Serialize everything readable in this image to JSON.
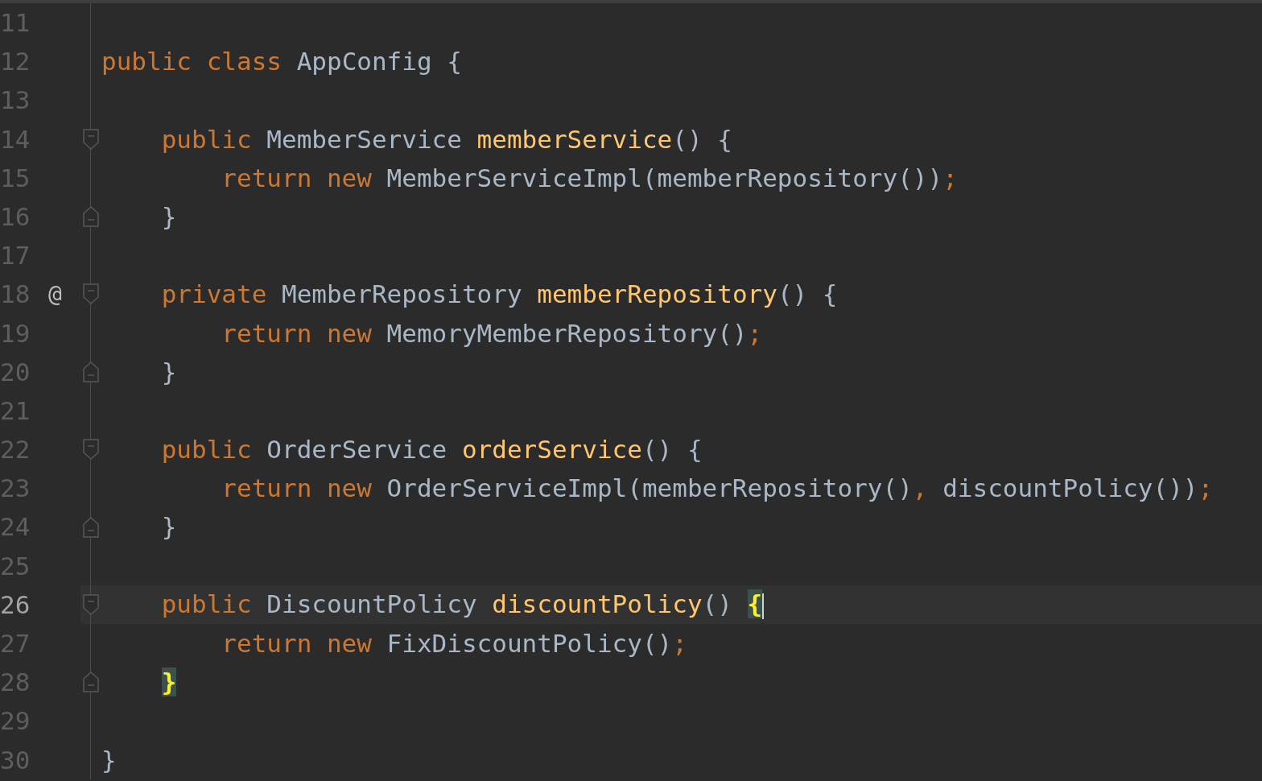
{
  "lines": [
    {
      "number": "11",
      "current": false,
      "caret": false,
      "fold_start": false,
      "fold_end": false
    },
    {
      "number": "12",
      "current": false,
      "caret": false,
      "fold_start": false,
      "fold_end": false,
      "tokens": [
        {
          "kind": "keyword",
          "text": "public class "
        },
        {
          "kind": "plain",
          "text": "AppConfig {"
        }
      ]
    },
    {
      "number": "13",
      "current": false,
      "caret": false,
      "fold_start": false,
      "fold_end": false
    },
    {
      "number": "14",
      "current": false,
      "caret": false,
      "fold_start": true,
      "fold_end": false,
      "tokens": [
        {
          "kind": "keyword",
          "text": "    public "
        },
        {
          "kind": "plain",
          "text": "MemberService "
        },
        {
          "kind": "method",
          "text": "memberService"
        },
        {
          "kind": "plain",
          "text": "() {"
        }
      ]
    },
    {
      "number": "15",
      "current": false,
      "caret": false,
      "fold_start": false,
      "fold_end": false,
      "tokens": [
        {
          "kind": "keyword",
          "text": "        return new "
        },
        {
          "kind": "plain",
          "text": "MemberServiceImpl(memberRepository())"
        },
        {
          "kind": "keyword",
          "text": ";"
        }
      ]
    },
    {
      "number": "16",
      "current": false,
      "caret": false,
      "fold_start": false,
      "fold_end": true,
      "tokens": [
        {
          "kind": "plain",
          "text": "    }"
        }
      ]
    },
    {
      "number": "17",
      "current": false,
      "caret": false,
      "fold_start": false,
      "fold_end": false
    },
    {
      "number": "18",
      "current": false,
      "caret": false,
      "fold_start": true,
      "fold_end": false,
      "gutter_mark": "@",
      "tokens": [
        {
          "kind": "keyword",
          "text": "    private "
        },
        {
          "kind": "plain",
          "text": "MemberRepository "
        },
        {
          "kind": "method",
          "text": "memberRepository"
        },
        {
          "kind": "plain",
          "text": "() {"
        }
      ]
    },
    {
      "number": "19",
      "current": false,
      "caret": false,
      "fold_start": false,
      "fold_end": false,
      "tokens": [
        {
          "kind": "keyword",
          "text": "        return new "
        },
        {
          "kind": "plain",
          "text": "MemoryMemberRepository()"
        },
        {
          "kind": "keyword",
          "text": ";"
        }
      ]
    },
    {
      "number": "20",
      "current": false,
      "caret": false,
      "fold_start": false,
      "fold_end": true,
      "tokens": [
        {
          "kind": "plain",
          "text": "    }"
        }
      ]
    },
    {
      "number": "21",
      "current": false,
      "caret": false,
      "fold_start": false,
      "fold_end": false
    },
    {
      "number": "22",
      "current": false,
      "caret": false,
      "fold_start": true,
      "fold_end": false,
      "tokens": [
        {
          "kind": "keyword",
          "text": "    public "
        },
        {
          "kind": "plain",
          "text": "OrderService "
        },
        {
          "kind": "method",
          "text": "orderService"
        },
        {
          "kind": "plain",
          "text": "() {"
        }
      ]
    },
    {
      "number": "23",
      "current": false,
      "caret": false,
      "fold_start": false,
      "fold_end": false,
      "tokens": [
        {
          "kind": "keyword",
          "text": "        return new "
        },
        {
          "kind": "plain",
          "text": "OrderServiceImpl(memberRepository()"
        },
        {
          "kind": "keyword",
          "text": ", "
        },
        {
          "kind": "plain",
          "text": "discountPolicy())"
        },
        {
          "kind": "keyword",
          "text": ";"
        }
      ]
    },
    {
      "number": "24",
      "current": false,
      "caret": false,
      "fold_start": false,
      "fold_end": true,
      "tokens": [
        {
          "kind": "plain",
          "text": "    }"
        }
      ]
    },
    {
      "number": "25",
      "current": false,
      "caret": false,
      "fold_start": false,
      "fold_end": false
    },
    {
      "number": "26",
      "current": true,
      "caret": true,
      "fold_start": true,
      "fold_end": false,
      "tokens": [
        {
          "kind": "keyword",
          "text": "    public "
        },
        {
          "kind": "plain",
          "text": "DiscountPolicy "
        },
        {
          "kind": "method",
          "text": "discountPolicy"
        },
        {
          "kind": "plain",
          "text": "() "
        },
        {
          "kind": "brace-match",
          "text": "{"
        }
      ]
    },
    {
      "number": "27",
      "current": false,
      "caret": false,
      "fold_start": false,
      "fold_end": false,
      "tokens": [
        {
          "kind": "keyword",
          "text": "        return new "
        },
        {
          "kind": "plain",
          "text": "FixDiscountPolicy()"
        },
        {
          "kind": "keyword",
          "text": ";"
        }
      ]
    },
    {
      "number": "28",
      "current": false,
      "caret": false,
      "fold_start": false,
      "fold_end": true,
      "tokens": [
        {
          "kind": "brace-match",
          "text": "    }"
        }
      ]
    },
    {
      "number": "29",
      "current": false,
      "caret": false,
      "fold_start": false,
      "fold_end": false
    },
    {
      "number": "30",
      "current": false,
      "caret": false,
      "fold_start": false,
      "fold_end": false,
      "tokens": [
        {
          "kind": "plain",
          "text": "}"
        }
      ]
    }
  ]
}
